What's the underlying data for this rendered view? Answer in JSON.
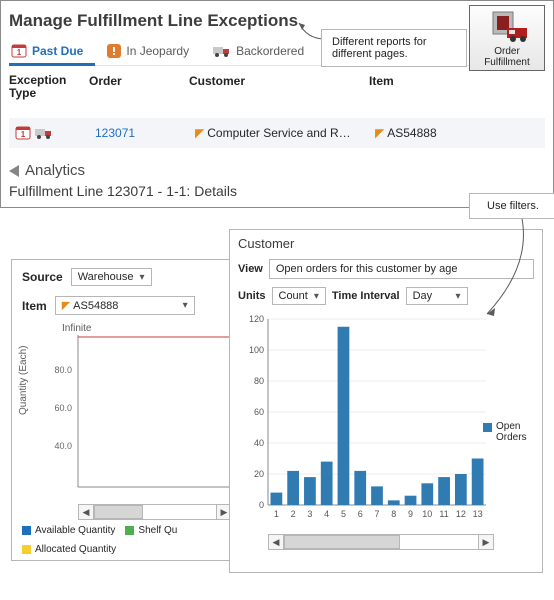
{
  "page_title": "Manage Fulfillment Line Exceptions",
  "tabs": [
    {
      "label": "Past Due",
      "active": true
    },
    {
      "label": "In Jeopardy",
      "active": false
    },
    {
      "label": "Backordered",
      "active": false
    }
  ],
  "fulfillment_button": "Order Fulfillment",
  "callouts": {
    "reports": "Different reports for different pages.",
    "filters": "Use filters."
  },
  "grid": {
    "headers": {
      "type": "Exception Type",
      "order": "Order",
      "customer": "Customer",
      "item": "Item"
    },
    "row": {
      "order": "123071",
      "customer": "Computer Service and R…",
      "item": "AS54888"
    }
  },
  "analytics": {
    "title": "Analytics",
    "subtitle": "Fulfillment Line 123071 - 1-1: Details"
  },
  "source_panel": {
    "title": "Source",
    "source_value": "Warehouse",
    "item_label": "Item",
    "item_value": "AS54888",
    "infinite": "Infinite",
    "ylabel": "Quantity (Each)",
    "legend": {
      "avail": "Available Quantity",
      "shelf": "Shelf Qu",
      "alloc": "Allocated Quantity"
    }
  },
  "customer_panel": {
    "title": "Customer",
    "view_label": "View",
    "view_value": "Open orders for this customer by age",
    "units_label": "Units",
    "units_value": "Count",
    "interval_label": "Time Interval",
    "interval_value": "Day",
    "legend": "Open Orders"
  },
  "chart_data": {
    "type": "bar",
    "title": "",
    "xlabel": "",
    "ylabel": "",
    "ylim": [
      0,
      120
    ],
    "categories": [
      1,
      2,
      3,
      4,
      5,
      6,
      7,
      8,
      9,
      10,
      11,
      12,
      13
    ],
    "series": [
      {
        "name": "Open Orders",
        "values": [
          8,
          22,
          18,
          28,
          115,
          22,
          12,
          3,
          6,
          14,
          18,
          20,
          30
        ]
      }
    ]
  }
}
